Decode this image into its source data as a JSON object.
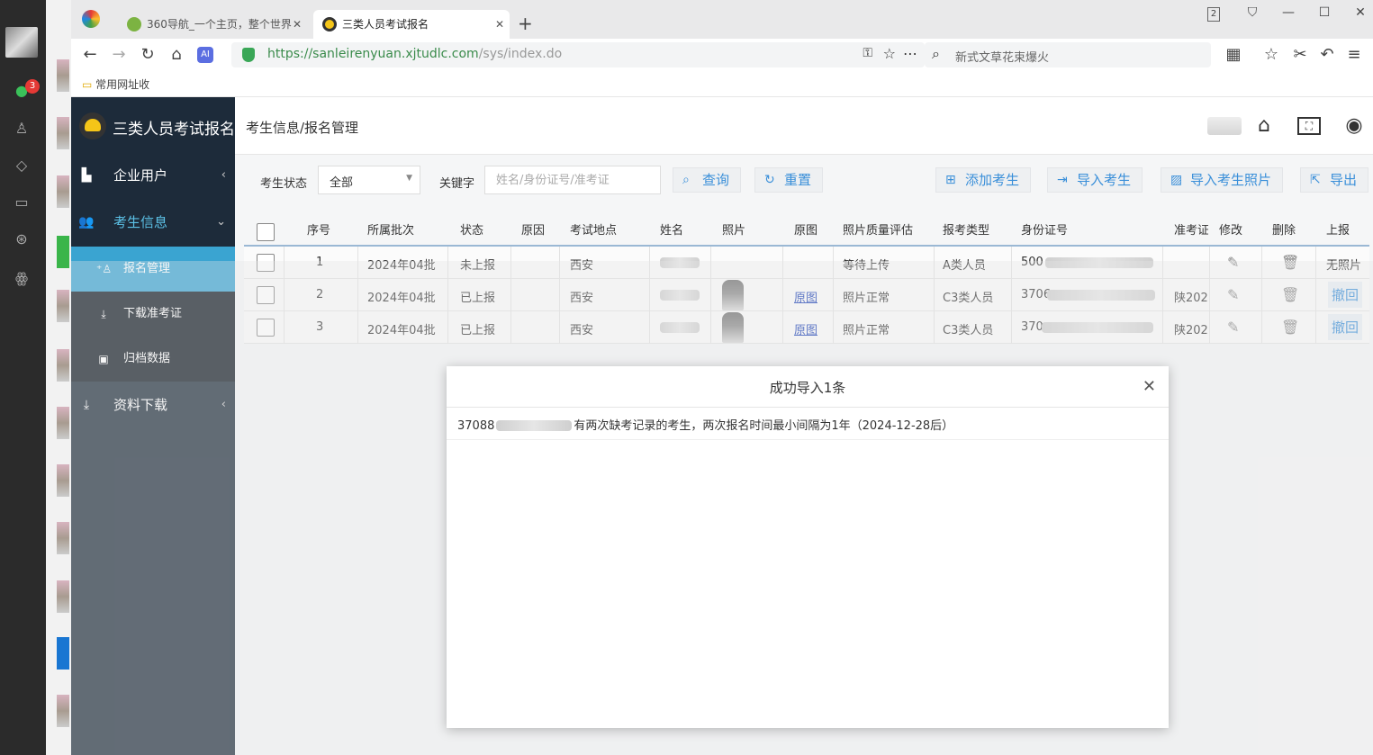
{
  "os": {
    "badge": "3"
  },
  "browser": {
    "tabs": [
      {
        "label": "360导航_一个主页，整个世界",
        "active": false
      },
      {
        "label": "三类人员考试报名",
        "active": true
      }
    ],
    "window_counter": "2",
    "url_host": "https://sanleirenyuan.xjtudlc.com",
    "url_path": "/sys/index.do",
    "search_text": "新式文草花束爆火",
    "bookmark": "常用网址收"
  },
  "sidebar": {
    "brand": "三类人员考试报名",
    "menu": [
      {
        "label": "企业用户",
        "arrow": "‹"
      },
      {
        "label": "考生信息",
        "arrow": "⌄"
      }
    ],
    "submenu": [
      {
        "label": "报名管理"
      },
      {
        "label": "下载准考证"
      },
      {
        "label": "归档数据"
      }
    ],
    "menu_bottom": {
      "label": "资料下载",
      "arrow": "‹"
    }
  },
  "topbar": {
    "breadcrumb": "考生信息/报名管理"
  },
  "toolbar": {
    "status_label": "考生状态",
    "status_value": "全部",
    "keyword_label": "关键字",
    "keyword_placeholder": "姓名/身份证号/准考证",
    "buttons": [
      "查询",
      "重置",
      "添加考生",
      "导入考生",
      "导入考生照片",
      "导出"
    ]
  },
  "table": {
    "headers": [
      "序号",
      "所属批次",
      "状态",
      "原因",
      "考试地点",
      "姓名",
      "照片",
      "原图",
      "照片质量评估",
      "报考类型",
      "身份证号",
      "准考证",
      "修改",
      "删除",
      "上报"
    ],
    "rows": [
      {
        "index": "1",
        "batch": "2024年04批",
        "status": "未上报",
        "reason": "",
        "location": "西安",
        "original": "",
        "quality": "等待上传",
        "type": "A类人员",
        "id_prefix": "500",
        "ticket": "",
        "report": "无照片"
      },
      {
        "index": "2",
        "batch": "2024年04批",
        "status": "已上报",
        "reason": "",
        "location": "西安",
        "original": "原图",
        "quality": "照片正常",
        "type": "C3类人员",
        "id_prefix": "3706",
        "ticket": "陕202",
        "report": "撤回"
      },
      {
        "index": "3",
        "batch": "2024年04批",
        "status": "已上报",
        "reason": "",
        "location": "西安",
        "original": "原图",
        "quality": "照片正常",
        "type": "C3类人员",
        "id_prefix": "370",
        "ticket": "陕202",
        "report": "撤回"
      }
    ]
  },
  "modal": {
    "title": "成功导入1条",
    "msg_prefix": "37088",
    "msg_suffix": "有两次缺考记录的考生，两次报名时间最小间隔为1年（2024-12-28后）"
  }
}
